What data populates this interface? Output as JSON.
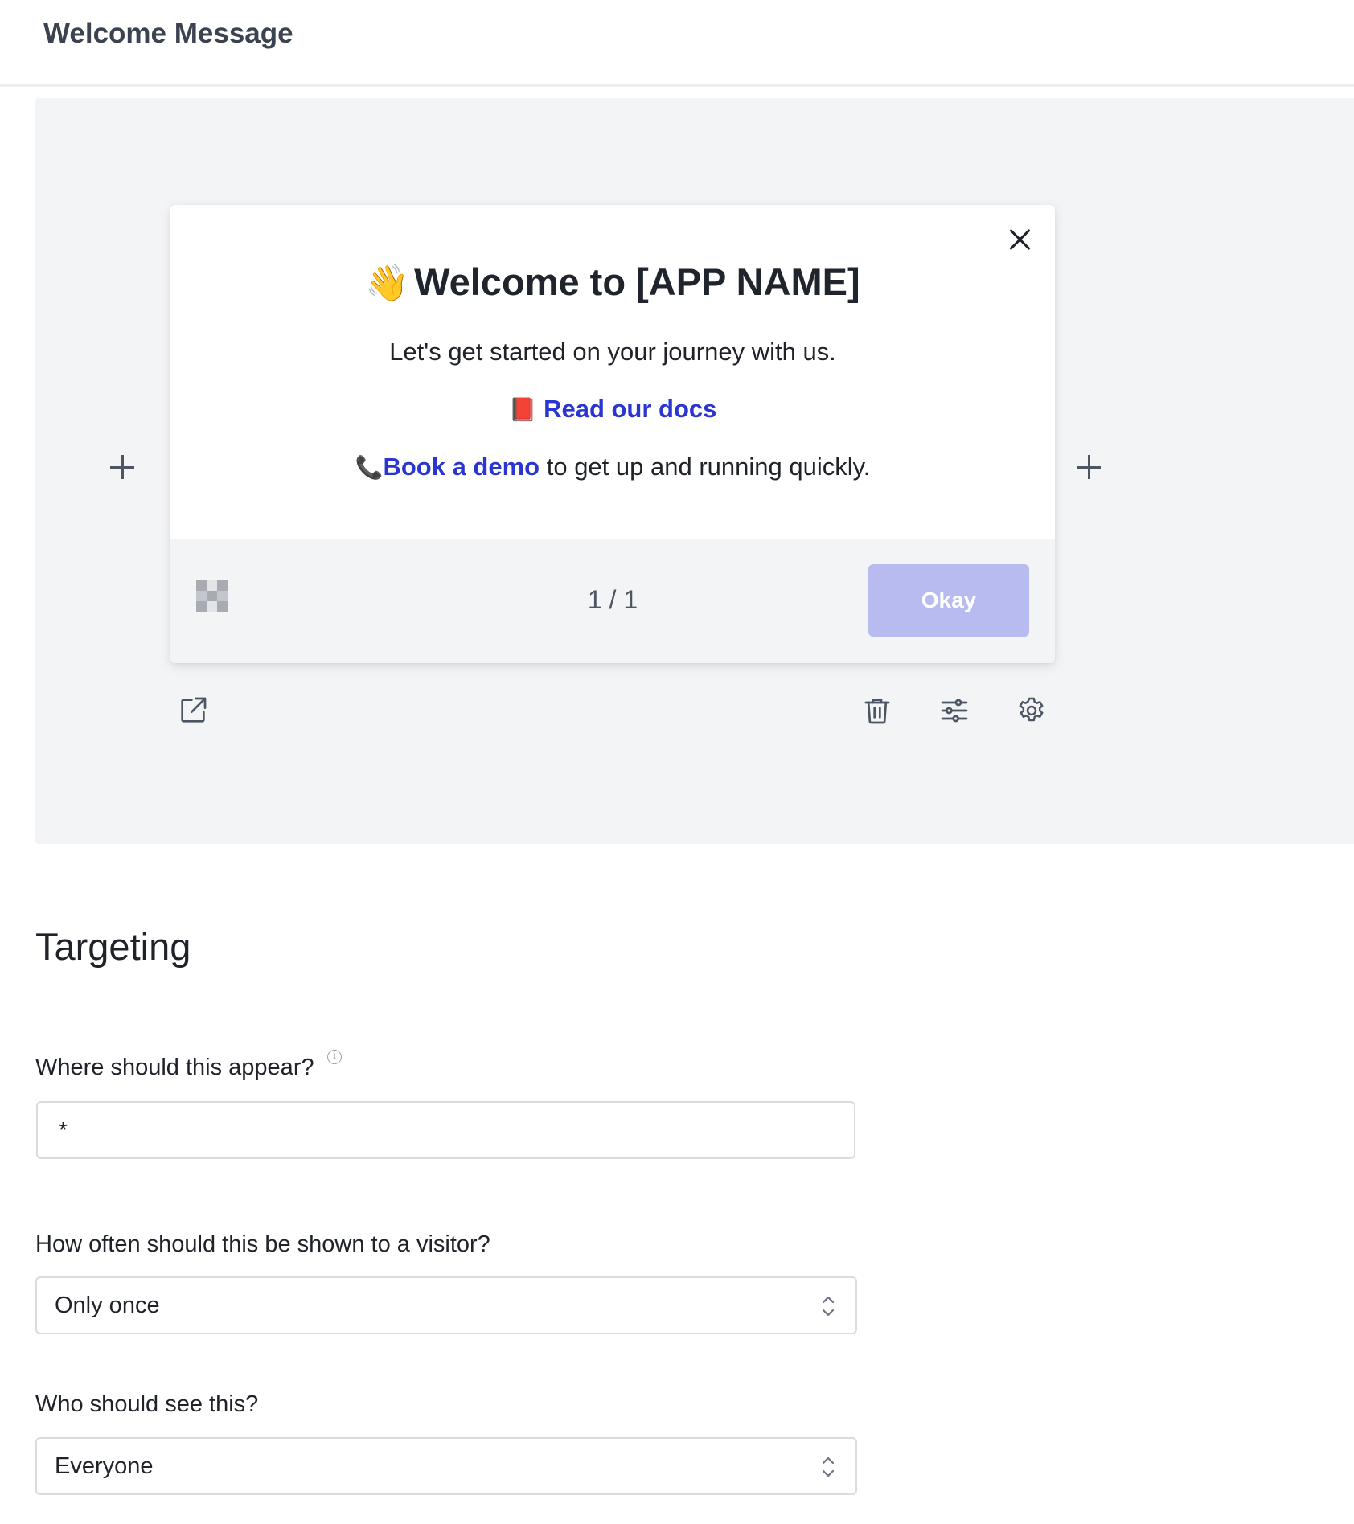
{
  "header": {
    "title": "Welcome Message"
  },
  "card": {
    "wave_emoji": "👋",
    "heading": "Welcome to [APP NAME]",
    "intro": "Let's get started on your journey with us.",
    "docs_emoji": "📕",
    "docs_link": "Read our docs",
    "demo_emoji": "📞",
    "demo_link": "Book a demo",
    "demo_suffix": " to get up and running quickly.",
    "step_counter": "1 / 1",
    "okay_label": "Okay"
  },
  "targeting": {
    "section_title": "Targeting",
    "where_label": "Where should this appear?",
    "where_value": "*",
    "how_often_label": "How often should this be shown to a visitor?",
    "how_often_value": "Only once",
    "who_label": "Who should see this?",
    "who_value": "Everyone"
  },
  "colors": {
    "link": "#2b35d0",
    "okay_button": "#b8bbf0",
    "canvas_bg": "#f3f4f6"
  },
  "icons": {
    "close": "close-icon",
    "add_left": "plus-icon",
    "add_right": "plus-icon",
    "edit": "external-edit-icon",
    "delete": "trash-icon",
    "adjust": "sliders-icon",
    "settings": "gear-icon",
    "info": "info-icon",
    "select": "chevron-up-down-icon"
  }
}
